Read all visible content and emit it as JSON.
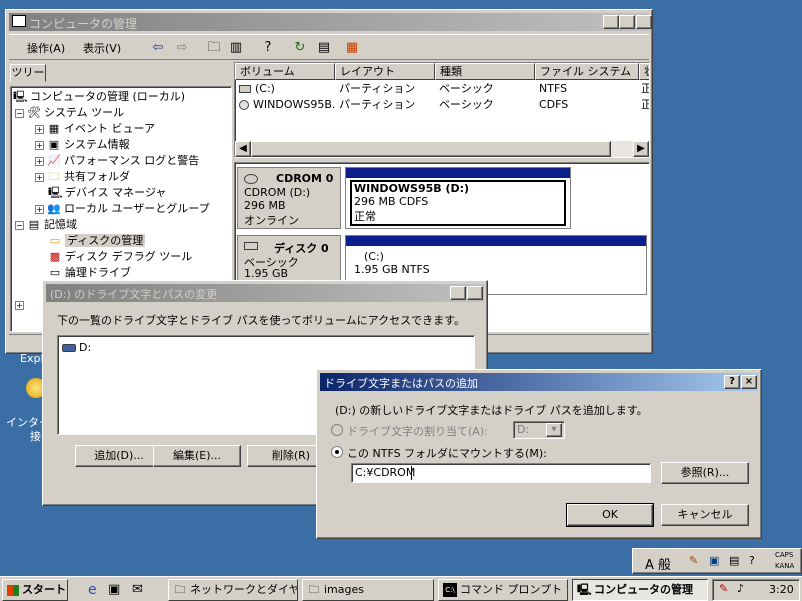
{
  "main_window": {
    "title": "コンピュータの管理",
    "menu": {
      "action": "操作(A)",
      "view": "表示(V)"
    },
    "tree_tab": "ツリー",
    "tree": [
      "コンピュータの管理 (ローカル)",
      "システム ツール",
      "イベント ビューア",
      "システム情報",
      "パフォーマンス ログと警告",
      "共有フォルダ",
      "デバイス マネージャ",
      "ローカル ユーザーとグループ",
      "記憶域",
      "ディスクの管理",
      "ディスク デフラグ ツール",
      "論理ドライブ"
    ],
    "columns": [
      "ボリューム",
      "レイアウト",
      "種類",
      "ファイル システム",
      "状"
    ],
    "volumes": [
      {
        "name": "(C:)",
        "layout": "パーティション",
        "type": "ベーシック",
        "fs": "NTFS",
        "status": "正"
      },
      {
        "name": "WINDOWS95B...",
        "layout": "パーティション",
        "type": "ベーシック",
        "fs": "CDFS",
        "status": "正"
      }
    ],
    "disks": [
      {
        "label": "CDROM 0",
        "sub1": "CDROM (D:)",
        "sub2": "296 MB",
        "sub3": "オンライン",
        "vol_name": "WINDOWS95B (D:)",
        "vol_size": "296 MB CDFS",
        "vol_status": "正常"
      },
      {
        "label": "ディスク 0",
        "sub1": "ベーシック",
        "sub2": "1.95 GB",
        "vol_name": "(C:)",
        "vol_size": "1.95 GB NTFS"
      }
    ]
  },
  "dialog1": {
    "title": "(D:) のドライブ文字とパスの変更",
    "description": "下の一覧のドライブ文字とドライブ パスを使ってボリュームにアクセスできます。",
    "list_items": [
      "D:"
    ],
    "add_button": "追加(D)...",
    "edit_button": "編集(E)...",
    "remove_button": "削除(R)"
  },
  "dialog2": {
    "title": "ドライブ文字またはパスの追加",
    "description": "(D:) の新しいドライブ文字またはドライブ パスを追加します。",
    "radio1_label": "ドライブ文字の割り当て(A):",
    "radio1_value": "D:",
    "radio2_label": "この NTFS フォルダにマウントする(M):",
    "path_value": "C:¥CDROM",
    "browse_button": "参照(R)...",
    "ok_button": "OK",
    "cancel_button": "キャンセル"
  },
  "desktop": {
    "label1": "Expl",
    "label2": "インター",
    "label3": "接"
  },
  "taskbar": {
    "start": "スタート",
    "tasks": [
      "ネットワークとダイヤル...",
      "images",
      "コマンド プロンプト",
      "コンピュータの管理"
    ],
    "clock": "3:20",
    "ime_mode": "A 般",
    "caps": "CAPS",
    "kana": "KANA"
  }
}
